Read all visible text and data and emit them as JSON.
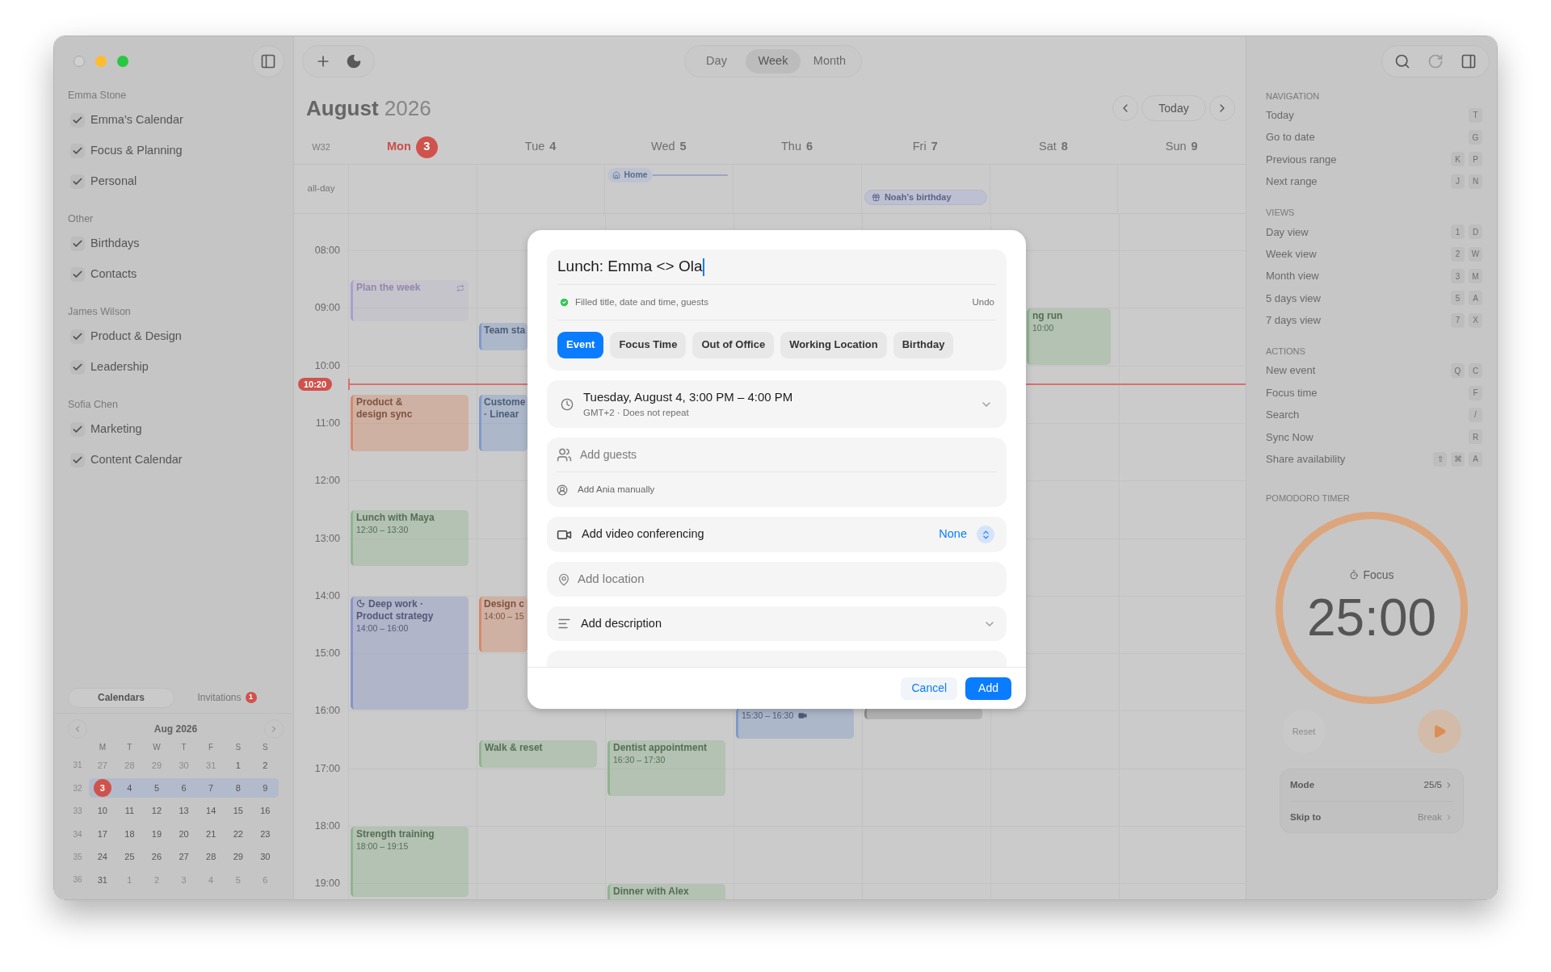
{
  "window": {
    "controls": [
      {
        "kind": "close",
        "disabled": true
      },
      {
        "kind": "minimize",
        "disabled": false
      },
      {
        "kind": "zoom",
        "disabled": false
      }
    ]
  },
  "sidebar": {
    "groups": [
      {
        "owner": "Emma Stone",
        "calendars": [
          {
            "name": "Emma's Calendar",
            "checked": true
          },
          {
            "name": "Focus & Planning",
            "checked": true
          },
          {
            "name": "Personal",
            "checked": true
          }
        ]
      },
      {
        "owner": "Other",
        "calendars": [
          {
            "name": "Birthdays",
            "checked": true
          },
          {
            "name": "Contacts",
            "checked": true
          }
        ]
      },
      {
        "owner": "James Wilson",
        "calendars": [
          {
            "name": "Product & Design",
            "checked": true
          },
          {
            "name": "Leadership",
            "checked": true
          }
        ]
      },
      {
        "owner": "Sofia Chen",
        "calendars": [
          {
            "name": "Marketing",
            "checked": true
          },
          {
            "name": "Content Calendar",
            "checked": true
          }
        ]
      }
    ],
    "tabs": [
      {
        "label": "Calendars",
        "selected": true
      },
      {
        "label": "Invitations",
        "selected": false,
        "badge": "1"
      }
    ],
    "mini_calendar": {
      "title": "Aug 2026",
      "weekdays": [
        "M",
        "T",
        "W",
        "T",
        "F",
        "S",
        "S"
      ],
      "weeks": [
        {
          "week": "31",
          "selected": false,
          "days": [
            {
              "day": "27",
              "muted": true,
              "today": false
            },
            {
              "day": "28",
              "muted": true,
              "today": false
            },
            {
              "day": "29",
              "muted": true,
              "today": false
            },
            {
              "day": "30",
              "muted": true,
              "today": false
            },
            {
              "day": "31",
              "muted": true,
              "today": false
            },
            {
              "day": "1",
              "muted": false,
              "today": false
            },
            {
              "day": "2",
              "muted": false,
              "today": false
            }
          ]
        },
        {
          "week": "32",
          "selected": true,
          "days": [
            {
              "day": "3",
              "muted": false,
              "today": true
            },
            {
              "day": "4",
              "muted": false,
              "today": false
            },
            {
              "day": "5",
              "muted": false,
              "today": false
            },
            {
              "day": "6",
              "muted": false,
              "today": false
            },
            {
              "day": "7",
              "muted": false,
              "today": false
            },
            {
              "day": "8",
              "muted": false,
              "today": false
            },
            {
              "day": "9",
              "muted": false,
              "today": false
            }
          ]
        },
        {
          "week": "33",
          "selected": false,
          "days": [
            {
              "day": "10",
              "muted": false,
              "today": false
            },
            {
              "day": "11",
              "muted": false,
              "today": false
            },
            {
              "day": "12",
              "muted": false,
              "today": false
            },
            {
              "day": "13",
              "muted": false,
              "today": false
            },
            {
              "day": "14",
              "muted": false,
              "today": false
            },
            {
              "day": "15",
              "muted": false,
              "today": false
            },
            {
              "day": "16",
              "muted": false,
              "today": false
            }
          ]
        },
        {
          "week": "34",
          "selected": false,
          "days": [
            {
              "day": "17",
              "muted": false,
              "today": false
            },
            {
              "day": "18",
              "muted": false,
              "today": false
            },
            {
              "day": "19",
              "muted": false,
              "today": false
            },
            {
              "day": "20",
              "muted": false,
              "today": false
            },
            {
              "day": "21",
              "muted": false,
              "today": false
            },
            {
              "day": "22",
              "muted": false,
              "today": false
            },
            {
              "day": "23",
              "muted": false,
              "today": false
            }
          ]
        },
        {
          "week": "35",
          "selected": false,
          "days": [
            {
              "day": "24",
              "muted": false,
              "today": false
            },
            {
              "day": "25",
              "muted": false,
              "today": false
            },
            {
              "day": "26",
              "muted": false,
              "today": false
            },
            {
              "day": "27",
              "muted": false,
              "today": false
            },
            {
              "day": "28",
              "muted": false,
              "today": false
            },
            {
              "day": "29",
              "muted": false,
              "today": false
            },
            {
              "day": "30",
              "muted": false,
              "today": false
            }
          ]
        },
        {
          "week": "36",
          "selected": false,
          "days": [
            {
              "day": "31",
              "muted": false,
              "today": false
            },
            {
              "day": "1",
              "muted": true,
              "today": false
            },
            {
              "day": "2",
              "muted": true,
              "today": false
            },
            {
              "day": "3",
              "muted": true,
              "today": false
            },
            {
              "day": "4",
              "muted": true,
              "today": false
            },
            {
              "day": "5",
              "muted": true,
              "today": false
            },
            {
              "day": "6",
              "muted": true,
              "today": false
            }
          ]
        }
      ]
    }
  },
  "toolbar": {
    "left_tools": [
      {
        "kind": "new"
      },
      {
        "kind": "focus"
      }
    ],
    "views": [
      {
        "label": "Day",
        "selected": false
      },
      {
        "label": "Week",
        "selected": true
      },
      {
        "label": "Month",
        "selected": false
      }
    ],
    "right_tools": [
      {
        "kind": "search",
        "disabled": false
      },
      {
        "kind": "sync",
        "disabled": true
      },
      {
        "kind": "panel",
        "disabled": false
      }
    ]
  },
  "calendar": {
    "month": "August",
    "year": "2026",
    "today_button": "Today",
    "week_label": "W32",
    "days": [
      {
        "name": "Mon",
        "date": "3",
        "today": true
      },
      {
        "name": "Tue",
        "date": "4",
        "today": false
      },
      {
        "name": "Wed",
        "date": "5",
        "today": false
      },
      {
        "name": "Thu",
        "date": "6",
        "today": false
      },
      {
        "name": "Fri",
        "date": "7",
        "today": false
      },
      {
        "name": "Sat",
        "date": "8",
        "today": false
      },
      {
        "name": "Sun",
        "date": "9",
        "today": false
      }
    ],
    "all_day_label": "all-day",
    "all_day_events": [
      {
        "title": "Home",
        "kind": "location"
      },
      {
        "title": "Noah's birthday",
        "kind": "birthday"
      }
    ],
    "hours": [
      "08:00",
      "09:00",
      "10:00",
      "11:00",
      "12:00",
      "13:00",
      "14:00",
      "15:00",
      "16:00",
      "17:00",
      "18:00",
      "19:00"
    ],
    "now": "10:20",
    "events": [
      {
        "title": "Plan the week",
        "color": "#a99fcf",
        "kind": "event",
        "faded": true,
        "repeats": true,
        "video": false
      },
      {
        "title": "Product &\ndesign sync",
        "color": "#d4896a",
        "kind": "event",
        "faded": false,
        "repeats": false,
        "video": false
      },
      {
        "title": "Lunch with Maya",
        "time": "12:30 – 13:30",
        "color": "#8fb58f",
        "kind": "event",
        "faded": false,
        "repeats": false,
        "video": false
      },
      {
        "title": "Deep work ·\nProduct strategy",
        "time": "14:00 – 16:00",
        "color": "#8a93c9",
        "kind": "focus",
        "faded": false,
        "repeats": false,
        "video": false
      },
      {
        "title": "Strength training",
        "time": "18:00 – 19:15",
        "color": "#8fb58f",
        "kind": "event",
        "faded": false,
        "repeats": false,
        "video": false
      },
      {
        "title": "Team sta",
        "color": "#7f99c8",
        "kind": "event",
        "faded": false,
        "repeats": false,
        "video": false
      },
      {
        "title": "Custome\n· Linear",
        "color": "#7f99c8",
        "kind": "event",
        "faded": false,
        "repeats": false,
        "video": false
      },
      {
        "title": "Design c",
        "time": "14:00 – 15",
        "color": "#d4896a",
        "kind": "event",
        "faded": false,
        "repeats": false,
        "video": false
      },
      {
        "title": "Walk & reset",
        "color": "#8fb58f",
        "kind": "event",
        "faded": false,
        "repeats": false,
        "video": false
      },
      {
        "title": "Dentist appointment",
        "time": "16:30 – 17:30",
        "color": "#8fb58f",
        "kind": "event",
        "faded": false,
        "repeats": false,
        "video": false
      },
      {
        "title": "Dinner with Alex",
        "color": "#8fb58f",
        "kind": "event",
        "faded": false,
        "repeats": false,
        "video": false
      },
      {
        "time": "15:30 – 16:30",
        "color": "#7f99c8",
        "kind": "event",
        "faded": false,
        "repeats": false,
        "video": true
      },
      {
        "color": "#8c8c8c",
        "kind": "event",
        "faded": false,
        "repeats": false,
        "video": false
      },
      {
        "title": "ng run",
        "time": "10:00",
        "color": "#8fb58f",
        "kind": "event",
        "faded": false,
        "repeats": false,
        "video": false
      }
    ]
  },
  "dialog": {
    "title_value": "Lunch: Emma <> Ola",
    "autofill_note": "Filled title, date and time, guests",
    "undo": "Undo",
    "types": [
      {
        "label": "Event",
        "selected": true
      },
      {
        "label": "Focus Time",
        "selected": false
      },
      {
        "label": "Out of Office",
        "selected": false
      },
      {
        "label": "Working Location",
        "selected": false
      },
      {
        "label": "Birthday",
        "selected": false
      }
    ],
    "datetime": "Tuesday, August 4, 3:00 PM – 4:00 PM",
    "timezone_repeat": "GMT+2 · Does not repeat",
    "guests_placeholder": "Add guests",
    "guest_suggestion": "Add Ania manually",
    "video_label": "Add video conferencing",
    "video_value": "None",
    "location_placeholder": "Add location",
    "description_label": "Add description",
    "cancel": "Cancel",
    "add": "Add"
  },
  "shortcuts": [
    {
      "title": "NAVIGATION",
      "items": [
        {
          "label": "Today",
          "keys": [
            "T"
          ]
        },
        {
          "label": "Go to date",
          "keys": [
            "G"
          ]
        },
        {
          "label": "Previous range",
          "keys": [
            "K",
            "P"
          ]
        },
        {
          "label": "Next range",
          "keys": [
            "J",
            "N"
          ]
        }
      ]
    },
    {
      "title": "VIEWS",
      "items": [
        {
          "label": "Day view",
          "keys": [
            "1",
            "D"
          ]
        },
        {
          "label": "Week view",
          "keys": [
            "2",
            "W"
          ]
        },
        {
          "label": "Month view",
          "keys": [
            "3",
            "M"
          ]
        },
        {
          "label": "5 days view",
          "keys": [
            "5",
            "A"
          ]
        },
        {
          "label": "7 days view",
          "keys": [
            "7",
            "X"
          ]
        }
      ]
    },
    {
      "title": "ACTIONS",
      "items": [
        {
          "label": "New event",
          "keys": [
            "Q",
            "C"
          ]
        },
        {
          "label": "Focus time",
          "keys": [
            "F"
          ]
        },
        {
          "label": "Search",
          "keys": [
            "/"
          ]
        },
        {
          "label": "Sync Now",
          "keys": [
            "R"
          ]
        },
        {
          "label": "Share availability",
          "keys": [
            "⇧",
            "⌘",
            "A"
          ]
        }
      ]
    }
  ],
  "pomodoro": {
    "title": "POMODORO TIMER",
    "mode_label": "Focus",
    "time": "25:00",
    "reset": "Reset",
    "reset_disabled": true,
    "settings": [
      {
        "label": "Mode",
        "value": "25/5",
        "disabled": false
      },
      {
        "label": "Skip to",
        "value": "Break",
        "disabled": true
      }
    ]
  }
}
